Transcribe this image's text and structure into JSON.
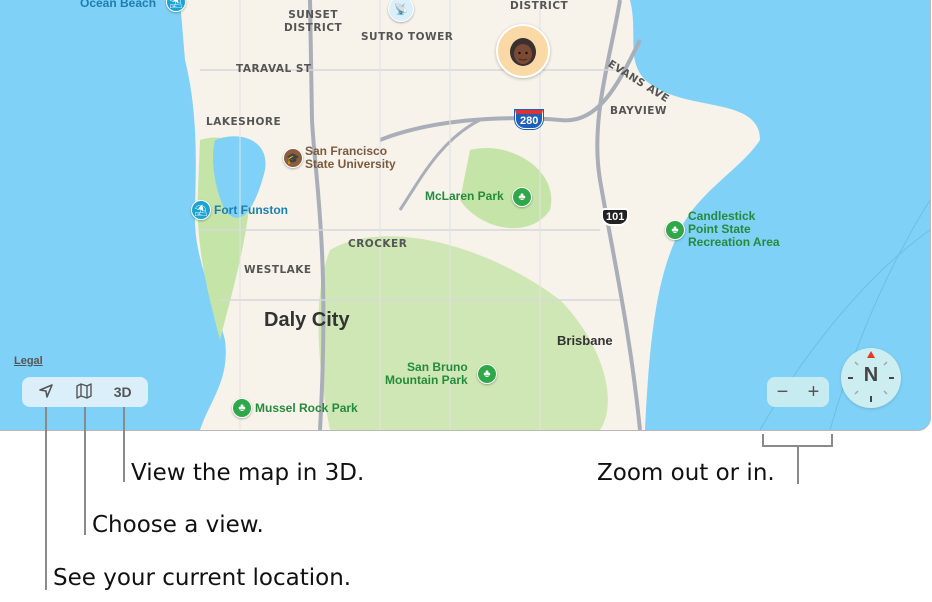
{
  "map": {
    "colors": {
      "water": "#80d1f7",
      "land": "#f7f3ea",
      "park": "#c5e5a8",
      "road": "#b8bcc6",
      "poi_green": "#258a3c",
      "poi_blue": "#1a7fb0"
    },
    "districts": [
      {
        "label": "SUNSET\nDISTRICT"
      },
      {
        "label": "DISTRICT"
      },
      {
        "label": "TARAVAL ST"
      },
      {
        "label": "LAKESHORE"
      },
      {
        "label": "BAYVIEW"
      },
      {
        "label": "EVANS AVE"
      },
      {
        "label": "CROCKER"
      },
      {
        "label": "WESTLAKE"
      }
    ],
    "cities": {
      "daly_city": "Daly City",
      "brisbane": "Brisbane"
    },
    "pois": {
      "ocean_beach": "Ocean Beach",
      "sutro_tower": "SUTRO TOWER",
      "sfsu_line1": "San Francisco",
      "sfsu_line2": "State University",
      "fort_funston": "Fort Funston",
      "mclaren_park": "McLaren Park",
      "candlestick_line1": "Candlestick",
      "candlestick_line2": "Point State",
      "candlestick_line3": "Recreation Area",
      "san_bruno_line1": "San Bruno",
      "san_bruno_line2": "Mountain Park",
      "mussel_rock": "Mussel Rock Park"
    },
    "highways": {
      "i280": "280",
      "us101": "101"
    },
    "legal_link": "Legal",
    "controls": {
      "location_icon": "location-arrow-icon",
      "view_icon": "map-icon",
      "three_d_label": "3D",
      "zoom_out": "−",
      "zoom_in": "+",
      "compass_label": "N"
    }
  },
  "callouts": {
    "three_d": "View the map in 3D.",
    "choose_view": "Choose a view.",
    "current_location": "See your current location.",
    "zoom": "Zoom out or in."
  }
}
